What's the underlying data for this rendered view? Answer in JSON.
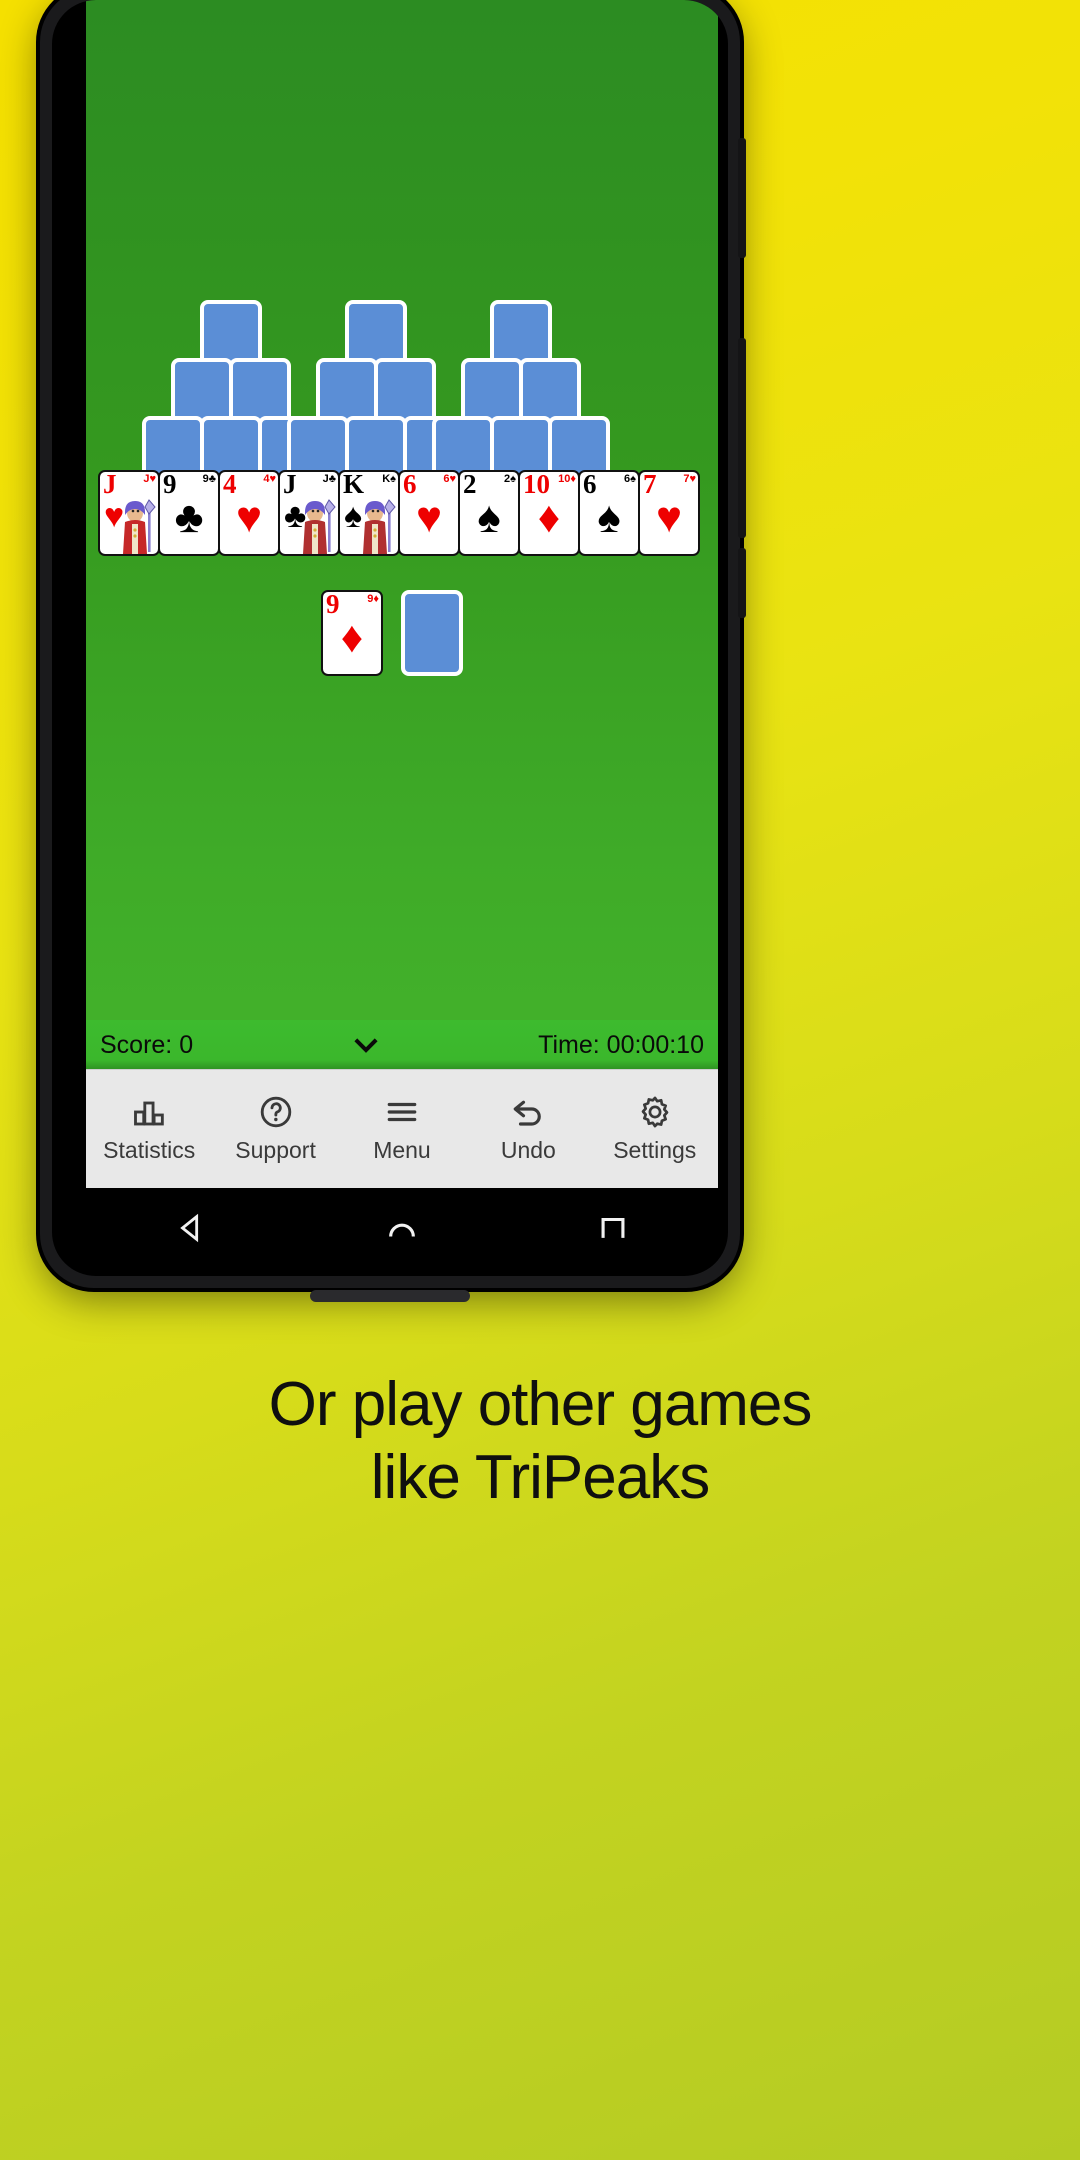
{
  "app": {
    "game_name": "TriPeaks",
    "table_color": "#35991f",
    "card_back_color": "#5b8ed6"
  },
  "board": {
    "peaks": 3,
    "rows": [
      {
        "name": "peak-top",
        "count": 3
      },
      {
        "name": "peak-second",
        "count": 6
      },
      {
        "name": "peak-third",
        "count": 9
      }
    ],
    "face_up_row": [
      {
        "rank": "J",
        "suit": "hearts",
        "symbol": "♥",
        "color": "red",
        "court": true
      },
      {
        "rank": "9",
        "suit": "clubs",
        "symbol": "♣",
        "color": "black",
        "court": false
      },
      {
        "rank": "4",
        "suit": "hearts",
        "symbol": "♥",
        "color": "red",
        "court": false
      },
      {
        "rank": "J",
        "suit": "clubs",
        "symbol": "♣",
        "color": "black",
        "court": true
      },
      {
        "rank": "K",
        "suit": "spades",
        "symbol": "♠",
        "color": "black",
        "court": true
      },
      {
        "rank": "6",
        "suit": "hearts",
        "symbol": "♥",
        "color": "red",
        "court": false
      },
      {
        "rank": "2",
        "suit": "spades",
        "symbol": "♠",
        "color": "black",
        "court": false
      },
      {
        "rank": "10",
        "suit": "diamonds",
        "symbol": "♦",
        "color": "red",
        "court": false
      },
      {
        "rank": "6",
        "suit": "spades",
        "symbol": "♠",
        "color": "black",
        "court": false
      },
      {
        "rank": "7",
        "suit": "hearts",
        "symbol": "♥",
        "color": "red",
        "court": false
      }
    ],
    "waste": {
      "rank": "9",
      "suit": "diamonds",
      "symbol": "♦",
      "color": "red"
    },
    "stock": {
      "face_down": true
    }
  },
  "status": {
    "score_label": "Score: 0",
    "time_label": "Time: 00:00:10",
    "collapse_icon": "chevron-down-icon"
  },
  "toolbar": [
    {
      "label": "Statistics",
      "icon": "bar-chart-icon"
    },
    {
      "label": "Support",
      "icon": "question-circle-icon"
    },
    {
      "label": "Menu",
      "icon": "hamburger-icon"
    },
    {
      "label": "Undo",
      "icon": "undo-arrow-icon"
    },
    {
      "label": "Settings",
      "icon": "gear-icon"
    }
  ],
  "navbar": [
    {
      "name": "back-nav-button",
      "icon": "triangle-back-icon"
    },
    {
      "name": "home-nav-button",
      "icon": "circle-home-icon"
    },
    {
      "name": "recents-nav-button",
      "icon": "square-recents-icon"
    }
  ],
  "caption": {
    "line1": "Or play other games",
    "line2": "like TriPeaks"
  }
}
